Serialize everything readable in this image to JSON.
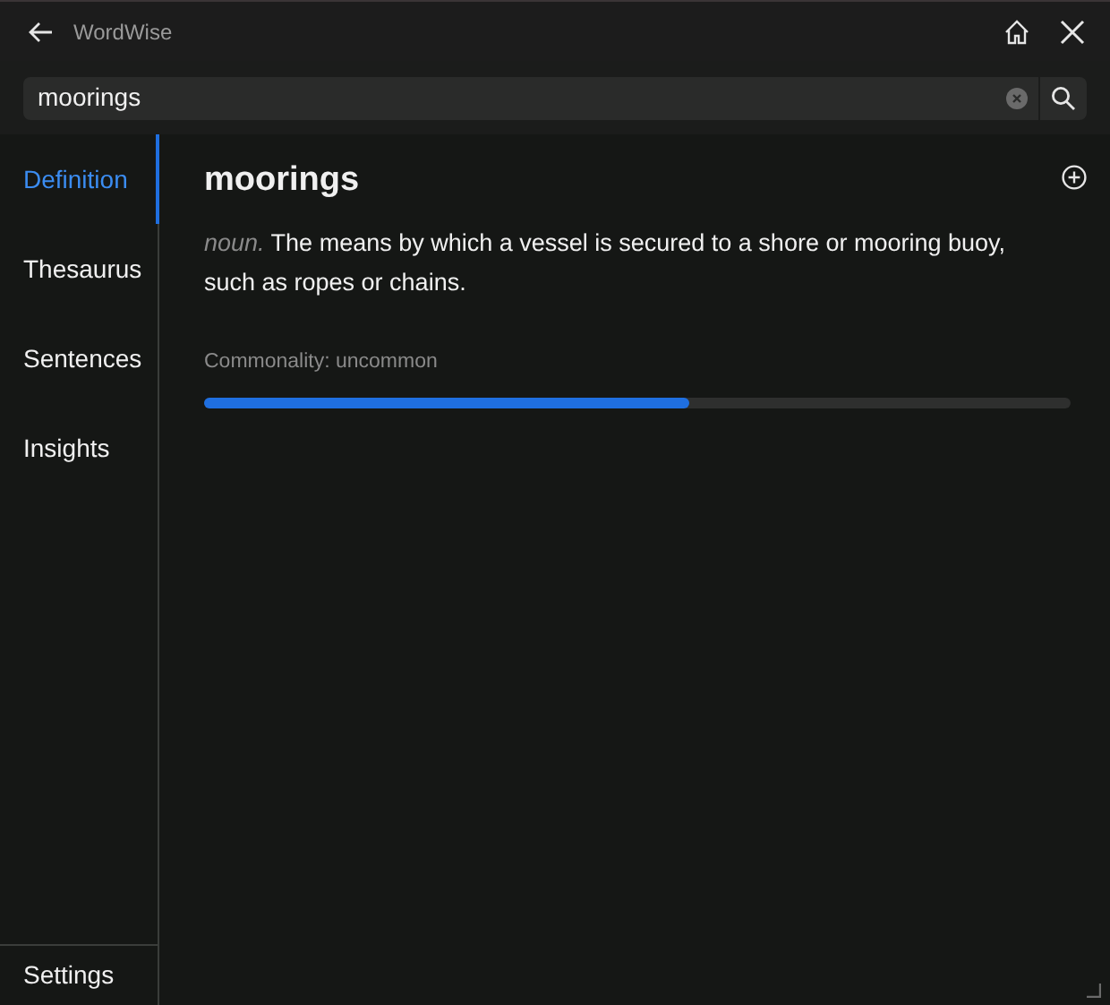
{
  "window": {
    "title": "WordWise"
  },
  "search": {
    "value": "moorings"
  },
  "sidebar": {
    "items": [
      {
        "label": "Definition",
        "selected": true
      },
      {
        "label": "Thesaurus",
        "selected": false
      },
      {
        "label": "Sentences",
        "selected": false
      },
      {
        "label": "Insights",
        "selected": false
      }
    ],
    "footer": "Settings"
  },
  "entry": {
    "word": "moorings",
    "part_of_speech": "noun.",
    "definition": "The means by which a vessel is secured to a shore or mooring buoy, such as ropes or chains.",
    "commonality": "Commonality: uncommon",
    "level": 0.56
  }
}
